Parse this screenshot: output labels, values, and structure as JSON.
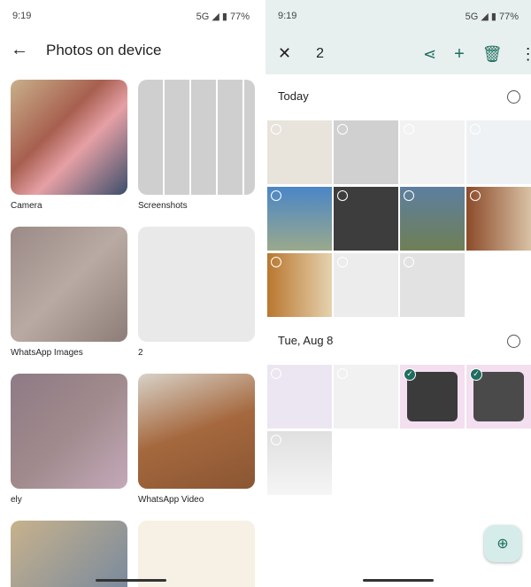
{
  "status": {
    "time": "9:19",
    "network": "5G",
    "battery": "77%"
  },
  "left": {
    "title": "Photos on device",
    "albums": [
      {
        "label": "Camera",
        "bg": "linear-gradient(135deg,#c9b08a,#a75f4f 40%,#e6a0a5 60%,#3c4e6b)"
      },
      {
        "label": "Screenshots",
        "bg": "repeating-linear-gradient(90deg,#cfcfcf 0 28px,#fff 28px 30px)"
      },
      {
        "label": "WhatsApp Images",
        "bg": "linear-gradient(135deg,#9b8a86,#b9aaa3,#8d7d78)"
      },
      {
        "label": "2",
        "bg": "#e9e9e9"
      },
      {
        "label": "ely",
        "bg": "linear-gradient(135deg,#8e7a86,#a08a8c,#c4a9b9)"
      },
      {
        "label": "WhatsApp Video",
        "bg": "linear-gradient(160deg,#d8d2c8,#a5683e 50%,#8a5633)"
      },
      {
        "label": "",
        "bg": "linear-gradient(135deg,#c8b28c,#7a8a9d)"
      },
      {
        "label": "",
        "bg": "#f6f1e4"
      }
    ]
  },
  "right": {
    "selected_count": "2",
    "sections": [
      {
        "label": "Today",
        "thumbs": [
          {
            "bg": "#e8e4dc",
            "sel": false
          },
          {
            "bg": "#d0d0d0",
            "sel": false
          },
          {
            "bg": "#f2f2f2",
            "sel": false
          },
          {
            "bg": "#eef2f4",
            "sel": false
          },
          {
            "bg": "linear-gradient(#4a86c7,#9aa98c)",
            "sel": false
          },
          {
            "bg": "#3d3d3d",
            "sel": false
          },
          {
            "bg": "linear-gradient(#5d7fa0,#6f7f55)",
            "sel": false
          },
          {
            "bg": "linear-gradient(90deg,#8c4b2a,#d9c2a5)",
            "sel": false
          },
          {
            "bg": "linear-gradient(90deg,#b9772f,#e6d2b0)",
            "sel": false
          },
          {
            "bg": "#ececec",
            "sel": false
          },
          {
            "bg": "#e2e2e2",
            "sel": false
          }
        ]
      },
      {
        "label": "Tue, Aug 8",
        "thumbs": [
          {
            "bg": "#ece6f2",
            "sel": false
          },
          {
            "bg": "#f1f1f1",
            "sel": false
          },
          {
            "bg": "#3b3b3b",
            "sel": true
          },
          {
            "bg": "#4a4a4a",
            "sel": true
          },
          {
            "bg": "linear-gradient(#e0e0e0,#f5f5f5)",
            "sel": false
          }
        ]
      }
    ]
  }
}
